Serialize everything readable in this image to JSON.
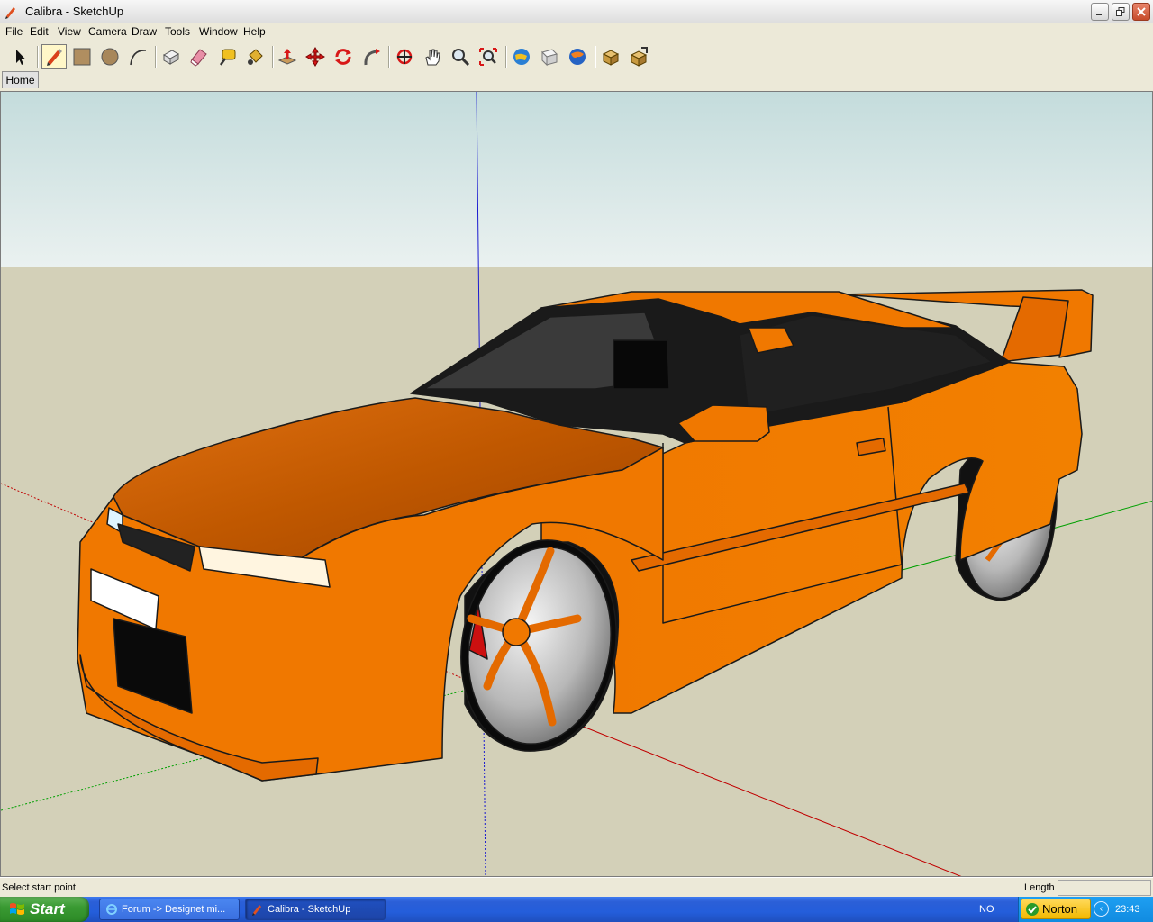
{
  "window": {
    "title": "Calibra - SketchUp",
    "icon": "sketchup-pencil-icon",
    "controls": [
      "minimize",
      "restore",
      "close"
    ]
  },
  "menu": [
    "File",
    "Edit",
    "View",
    "Camera",
    "Draw",
    "Tools",
    "Window",
    "Help"
  ],
  "toolbar": {
    "tools": [
      {
        "name": "select",
        "icon": "arrow-icon"
      },
      {
        "name": "line",
        "icon": "pencil-icon",
        "selected": true
      },
      {
        "name": "rectangle",
        "icon": "rectangle-icon"
      },
      {
        "name": "circle",
        "icon": "circle-icon"
      },
      {
        "name": "arc",
        "icon": "arc-icon"
      },
      {
        "name": "make-component",
        "icon": "component-icon"
      },
      {
        "name": "eraser",
        "icon": "eraser-icon"
      },
      {
        "name": "tape-measure",
        "icon": "tape-measure-icon"
      },
      {
        "name": "paint-bucket",
        "icon": "paint-bucket-icon"
      },
      {
        "name": "push-pull",
        "icon": "push-pull-icon"
      },
      {
        "name": "move",
        "icon": "move-icon"
      },
      {
        "name": "rotate",
        "icon": "rotate-icon"
      },
      {
        "name": "follow-me",
        "icon": "follow-me-icon"
      },
      {
        "name": "orbit",
        "icon": "orbit-icon"
      },
      {
        "name": "pan",
        "icon": "hand-icon"
      },
      {
        "name": "zoom",
        "icon": "magnifier-icon"
      },
      {
        "name": "zoom-extents",
        "icon": "zoom-extents-icon"
      },
      {
        "name": "get-models",
        "icon": "get-models-icon"
      },
      {
        "name": "share-model",
        "icon": "share-model-icon"
      },
      {
        "name": "google-earth",
        "icon": "google-earth-icon"
      },
      {
        "name": "get-component",
        "icon": "get-component-icon"
      },
      {
        "name": "share-component",
        "icon": "share-component-icon"
      }
    ]
  },
  "scene_tabs": [
    {
      "label": "Home",
      "active": true
    }
  ],
  "viewport": {
    "sky_color": "#cfe0e0",
    "ground_color": "#d3d0b8",
    "model_color": "#f07400",
    "axis_colors": {
      "red": "#cc0000",
      "green": "#00a000",
      "blue": "#0000cc"
    }
  },
  "statusbar": {
    "message": "Select start point",
    "measurement_label": "Length",
    "measurement_value": ""
  },
  "taskbar": {
    "start_label": "Start",
    "tasks": [
      {
        "label": "Forum -> Designet mi...",
        "icon": "ie-icon"
      },
      {
        "label": "Calibra - SketchUp",
        "icon": "sketchup-icon",
        "active": true
      }
    ],
    "language": "NO",
    "norton_label": "Norton",
    "clock": "23:43"
  }
}
